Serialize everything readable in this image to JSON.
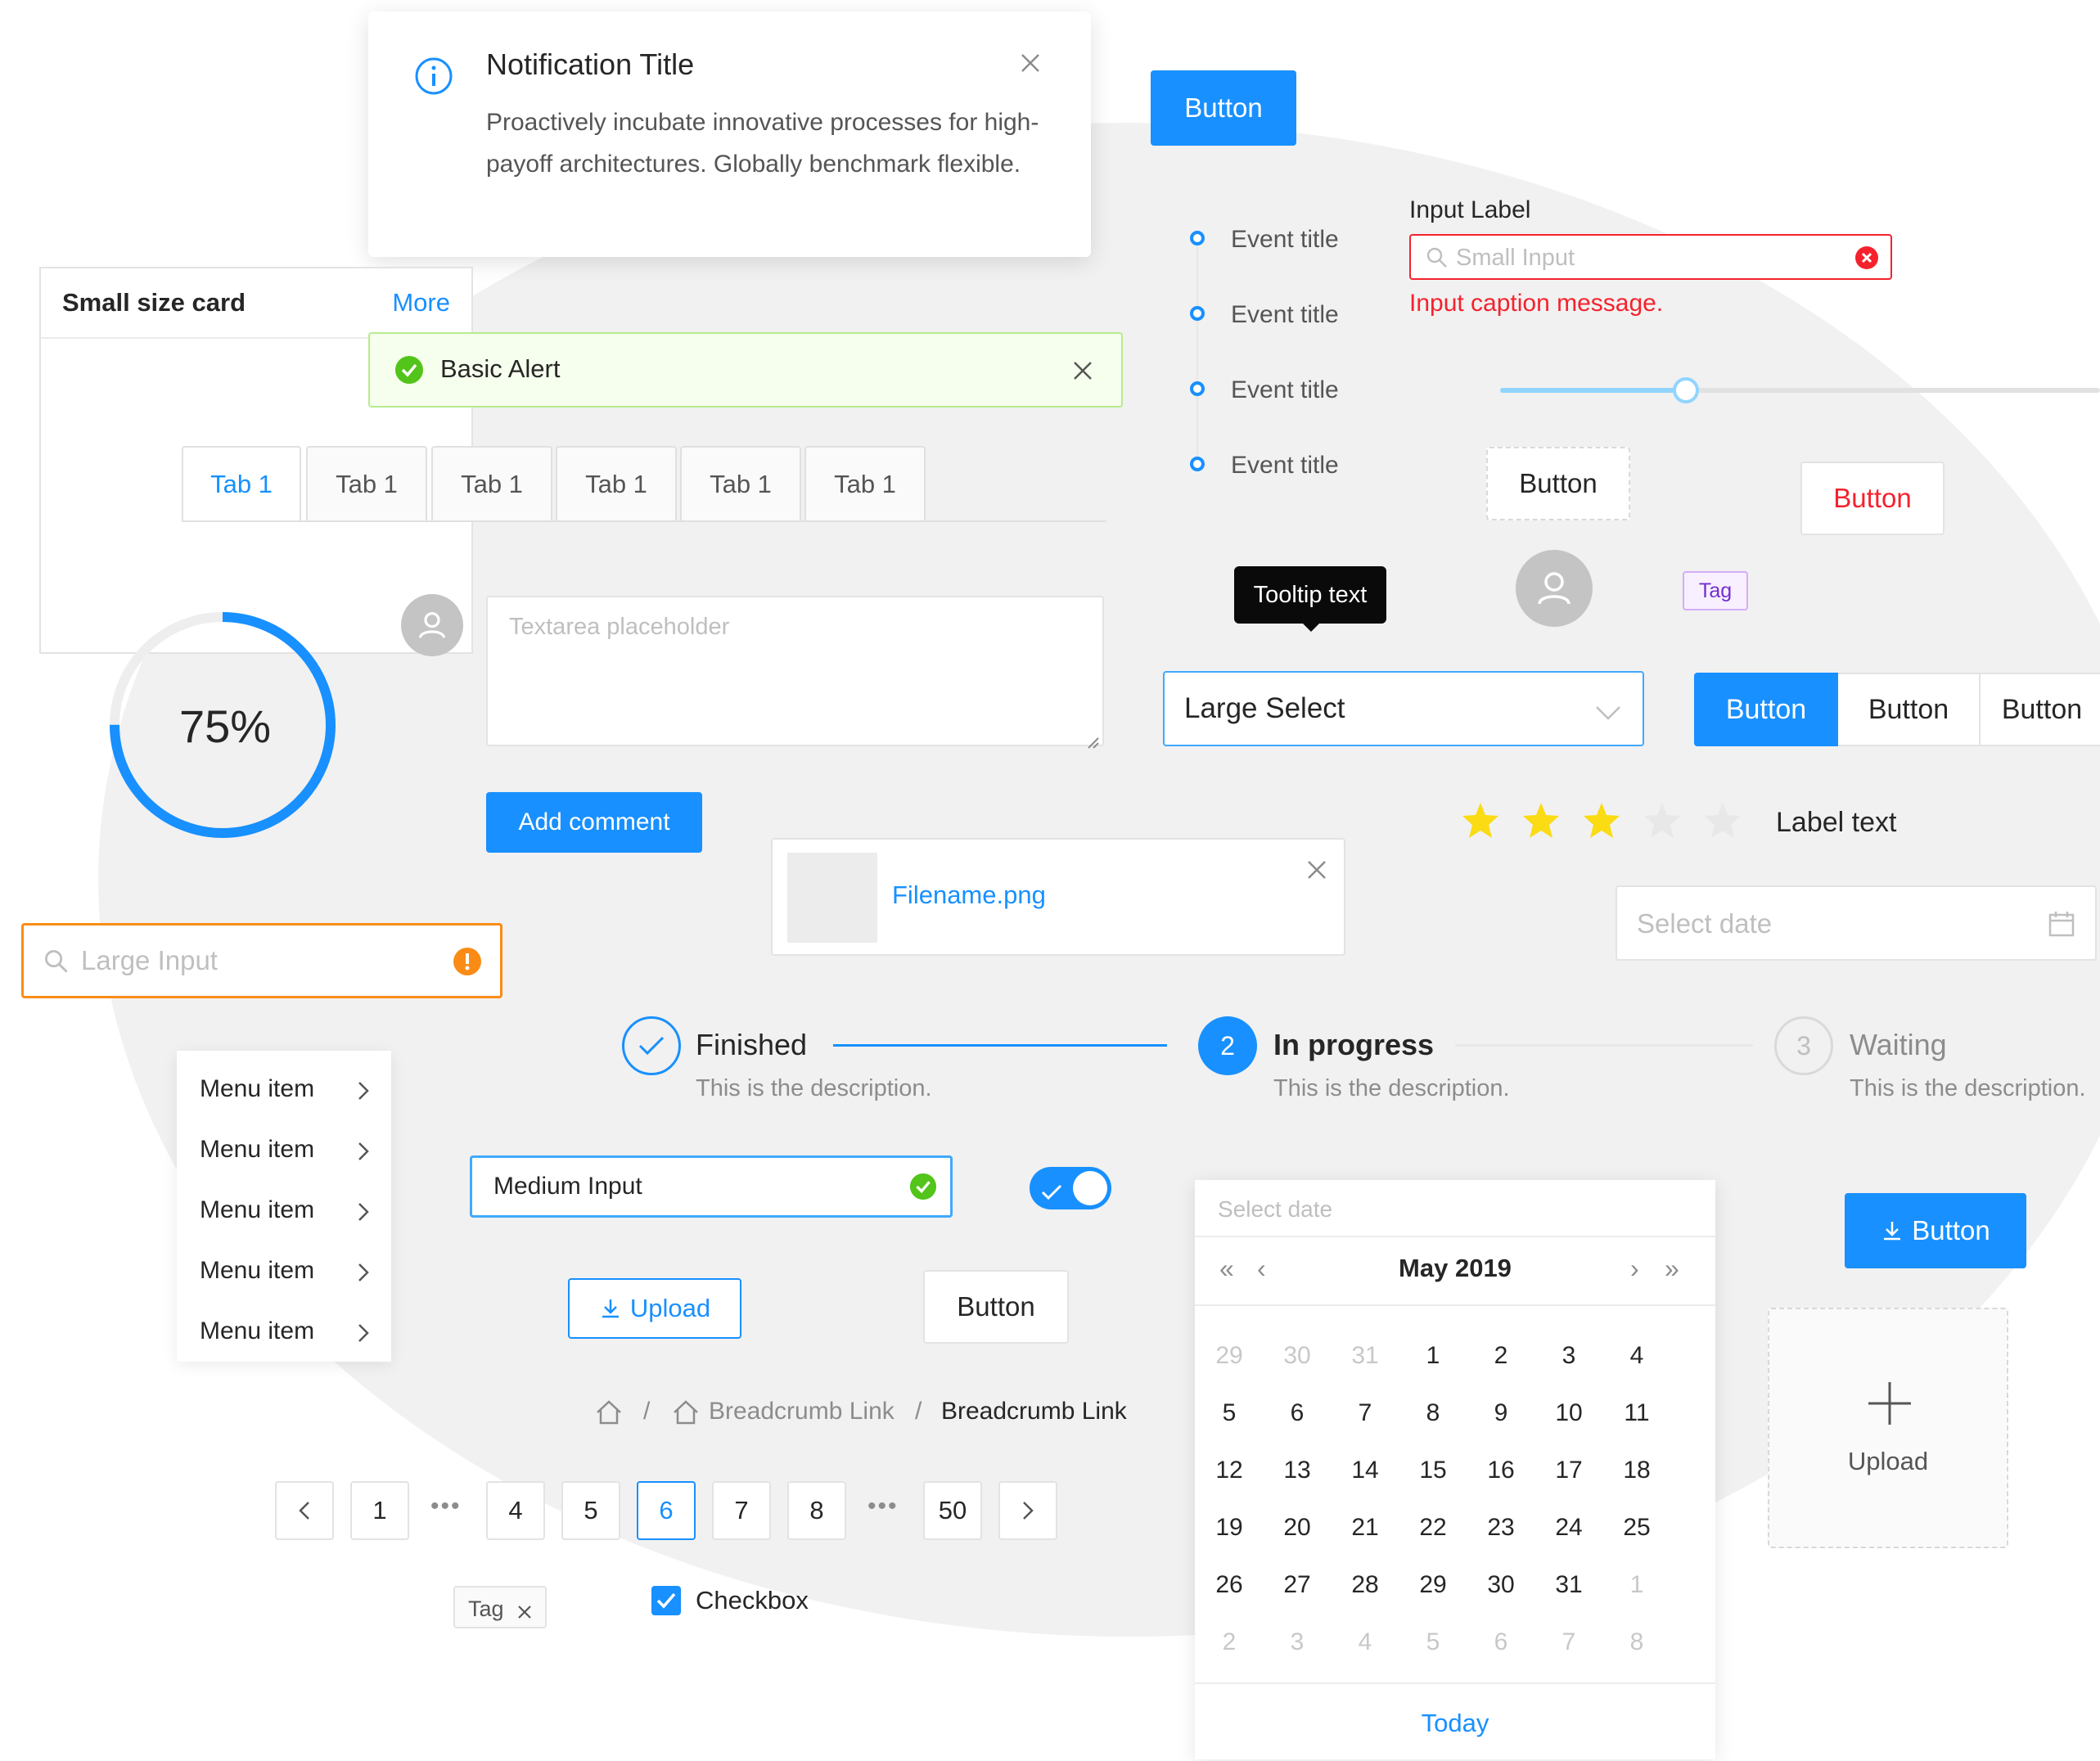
{
  "notification": {
    "title": "Notification Title",
    "body": "Proactively incubate innovative processes for high-payoff architectures. Globally benchmark flexible."
  },
  "card": {
    "title": "Small size card",
    "more": "More"
  },
  "alert": {
    "text": "Basic Alert"
  },
  "tabs": [
    "Tab 1",
    "Tab 1",
    "Tab 1",
    "Tab 1",
    "Tab 1",
    "Tab 1"
  ],
  "buttons": {
    "top_primary": "Button",
    "dashed": "Button",
    "danger": "Button",
    "add_comment": "Add comment",
    "upload_outline": "Upload",
    "default": "Button",
    "primary_icon": "Button"
  },
  "timeline": [
    "Event title",
    "Event title",
    "Event title",
    "Event title"
  ],
  "small_input": {
    "label": "Input Label",
    "placeholder": "Small Input",
    "caption": "Input caption message."
  },
  "slider": {
    "value_fraction": 0.31
  },
  "tooltip": {
    "text": "Tooltip text"
  },
  "tag_purple": "Tag",
  "large_select": {
    "value": "Large Select"
  },
  "radio_group": [
    "Button",
    "Button",
    "Button"
  ],
  "progress": {
    "percent": 75,
    "label": "75%"
  },
  "textarea": {
    "placeholder": "Textarea placeholder"
  },
  "file": {
    "name": "Filename.png"
  },
  "rate": {
    "value": 3,
    "max": 5,
    "label": "Label text"
  },
  "date_input": {
    "placeholder": "Select date"
  },
  "large_input": {
    "placeholder": "Large Input"
  },
  "menu": [
    "Menu item",
    "Menu item",
    "Menu item",
    "Menu item",
    "Menu item"
  ],
  "steps": [
    {
      "title": "Finished",
      "desc": "This is the description."
    },
    {
      "title": "In progress",
      "desc": "This is the description.",
      "number": "2"
    },
    {
      "title": "Waiting",
      "desc": "This is the description.",
      "number": "3"
    }
  ],
  "medium_input": {
    "value": "Medium Input"
  },
  "switch": {
    "on": true
  },
  "calendar": {
    "placeholder": "Select date",
    "title": "May 2019",
    "rows": [
      [
        "29",
        "30",
        "31",
        "1",
        "2",
        "3",
        "4"
      ],
      [
        "5",
        "6",
        "7",
        "8",
        "9",
        "10",
        "11"
      ],
      [
        "12",
        "13",
        "14",
        "15",
        "16",
        "17",
        "18"
      ],
      [
        "19",
        "20",
        "21",
        "22",
        "23",
        "24",
        "25"
      ],
      [
        "26",
        "27",
        "28",
        "29",
        "30",
        "31",
        "1"
      ],
      [
        "2",
        "3",
        "4",
        "5",
        "6",
        "7",
        "8"
      ]
    ],
    "today": "Today"
  },
  "upload_box": {
    "label": "Upload"
  },
  "breadcrumb": {
    "link": "Breadcrumb Link",
    "current": "Breadcrumb Link"
  },
  "pagination": {
    "pages": [
      "1",
      "4",
      "5",
      "6",
      "7",
      "8",
      "50"
    ],
    "current": "6"
  },
  "tag_close": "Tag",
  "checkbox": {
    "label": "Checkbox",
    "checked": true
  },
  "colors": {
    "primary": "#1890ff",
    "danger": "#f5222d",
    "success": "#52c41a",
    "warning": "#fa8c16",
    "star": "#fadb14"
  }
}
